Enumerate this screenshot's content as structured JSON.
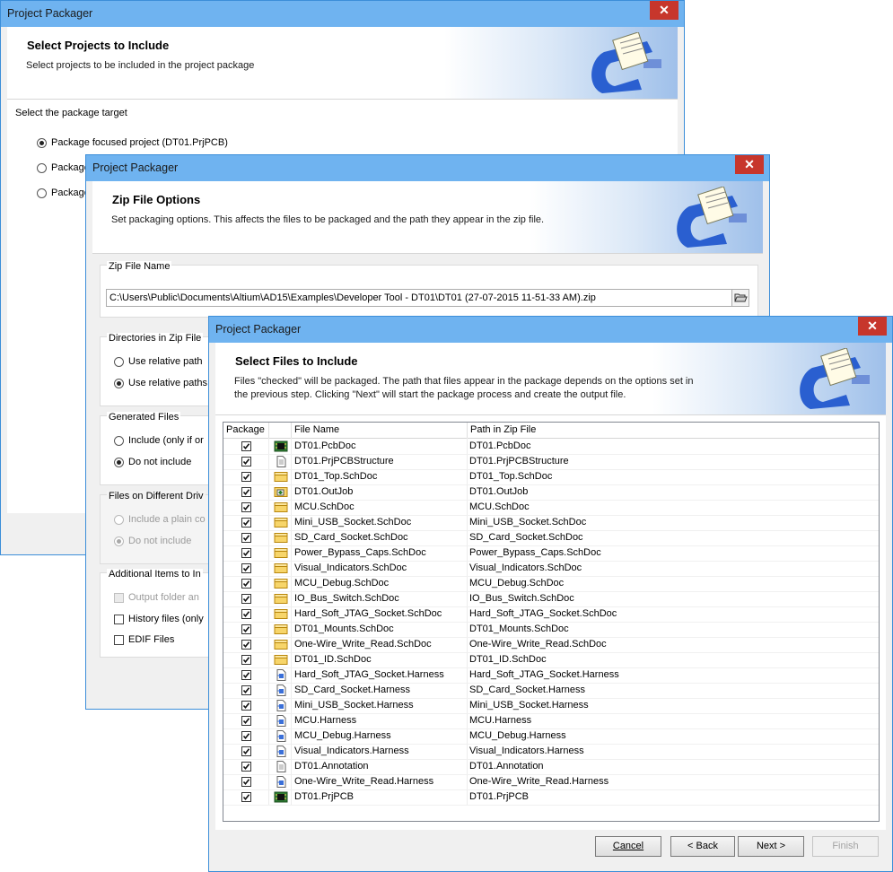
{
  "window1": {
    "title": "Project Packager",
    "heading": "Select Projects to Include",
    "subheading": "Select projects to be included in the project package",
    "section_label": "Select the package target",
    "options": [
      "Package focused project (DT01.PrjPCB)",
      "Package",
      "Package"
    ]
  },
  "window2": {
    "title": "Project Packager",
    "heading": "Zip File Options",
    "subheading": "Set packaging options. This affects the files to be packaged and the path they appear in the zip file.",
    "zip_label": "Zip File Name",
    "zip_path": "C:\\Users\\Public\\Documents\\Altium\\AD15\\Examples\\Developer Tool - DT01\\DT01 (27-07-2015 11-51-33 AM).zip",
    "dirs_label": "Directories in Zip File",
    "dirs_opt1": "Use relative path",
    "dirs_opt2": "Use relative paths",
    "gen_label": "Generated Files",
    "gen_opt1": "Include (only if or",
    "gen_opt2": "Do not include",
    "drives_label": "Files on Different Driv",
    "drives_opt1": "Include a plain co",
    "drives_opt2": "Do not include",
    "additional_label": "Additional Items to In",
    "add_opt1": "Output folder an",
    "add_opt2": "History files (only",
    "add_opt3": "EDIF Files"
  },
  "window3": {
    "title": "Project Packager",
    "heading": "Select Files to Include",
    "subheading_line1": "Files \"checked\" will be packaged. The path that files appear in the package depends on the options set in",
    "subheading_line2": "the previous step. Clicking \"Next\" will start the package process and create the output file.",
    "columns": {
      "package": "Package",
      "file_name": "File Name",
      "path": "Path in Zip File"
    },
    "files": [
      {
        "name": "DT01.PcbDoc",
        "path": "DT01.PcbDoc",
        "icon": "pcb-icon"
      },
      {
        "name": "DT01.PrjPCBStructure",
        "path": "DT01.PrjPCBStructure",
        "icon": "document-icon"
      },
      {
        "name": "DT01_Top.SchDoc",
        "path": "DT01_Top.SchDoc",
        "icon": "schematic-icon"
      },
      {
        "name": "DT01.OutJob",
        "path": "DT01.OutJob",
        "icon": "outjob-icon"
      },
      {
        "name": "MCU.SchDoc",
        "path": "MCU.SchDoc",
        "icon": "schematic-icon"
      },
      {
        "name": "Mini_USB_Socket.SchDoc",
        "path": "Mini_USB_Socket.SchDoc",
        "icon": "schematic-icon"
      },
      {
        "name": "SD_Card_Socket.SchDoc",
        "path": "SD_Card_Socket.SchDoc",
        "icon": "schematic-icon"
      },
      {
        "name": "Power_Bypass_Caps.SchDoc",
        "path": "Power_Bypass_Caps.SchDoc",
        "icon": "schematic-icon"
      },
      {
        "name": "Visual_Indicators.SchDoc",
        "path": "Visual_Indicators.SchDoc",
        "icon": "schematic-icon"
      },
      {
        "name": "MCU_Debug.SchDoc",
        "path": "MCU_Debug.SchDoc",
        "icon": "schematic-icon"
      },
      {
        "name": "IO_Bus_Switch.SchDoc",
        "path": "IO_Bus_Switch.SchDoc",
        "icon": "schematic-icon"
      },
      {
        "name": "Hard_Soft_JTAG_Socket.SchDoc",
        "path": "Hard_Soft_JTAG_Socket.SchDoc",
        "icon": "schematic-icon"
      },
      {
        "name": "DT01_Mounts.SchDoc",
        "path": "DT01_Mounts.SchDoc",
        "icon": "schematic-icon"
      },
      {
        "name": "One-Wire_Write_Read.SchDoc",
        "path": "One-Wire_Write_Read.SchDoc",
        "icon": "schematic-icon"
      },
      {
        "name": "DT01_ID.SchDoc",
        "path": "DT01_ID.SchDoc",
        "icon": "schematic-icon"
      },
      {
        "name": "Hard_Soft_JTAG_Socket.Harness",
        "path": "Hard_Soft_JTAG_Socket.Harness",
        "icon": "harness-icon"
      },
      {
        "name": "SD_Card_Socket.Harness",
        "path": "SD_Card_Socket.Harness",
        "icon": "harness-icon"
      },
      {
        "name": "Mini_USB_Socket.Harness",
        "path": "Mini_USB_Socket.Harness",
        "icon": "harness-icon"
      },
      {
        "name": "MCU.Harness",
        "path": "MCU.Harness",
        "icon": "harness-icon"
      },
      {
        "name": "MCU_Debug.Harness",
        "path": "MCU_Debug.Harness",
        "icon": "harness-icon"
      },
      {
        "name": "Visual_Indicators.Harness",
        "path": "Visual_Indicators.Harness",
        "icon": "harness-icon"
      },
      {
        "name": "DT01.Annotation",
        "path": "DT01.Annotation",
        "icon": "document-icon"
      },
      {
        "name": "One-Wire_Write_Read.Harness",
        "path": "One-Wire_Write_Read.Harness",
        "icon": "harness-icon"
      },
      {
        "name": "DT01.PrjPCB",
        "path": "DT01.PrjPCB",
        "icon": "pcb-icon"
      }
    ],
    "buttons": {
      "cancel": "Cancel",
      "back": "< Back",
      "next": "Next >",
      "finish": "Finish"
    }
  },
  "colors": {
    "titlebar": "#6fb3f0",
    "close": "#c7362c",
    "border": "#3c8ed9"
  }
}
